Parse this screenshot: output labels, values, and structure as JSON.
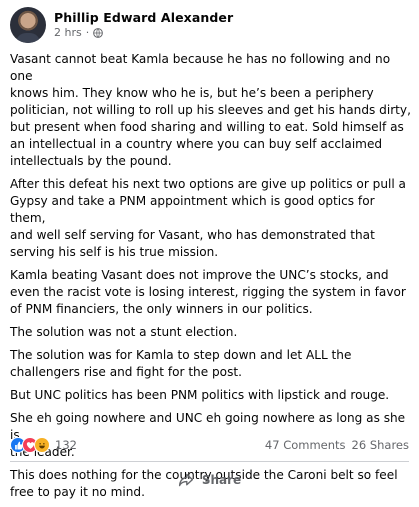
{
  "post": {
    "author": "Phillip Edward Alexander",
    "timestamp": "2 hrs",
    "separator": "·",
    "privacy_icon": "globe-icon",
    "paragraphs": [
      "Vasant cannot beat Kamla because he has no following and no one\nknows him. They know who he is, but he’s been a periphery\npolitician, not willing to roll up his sleeves and get his hands dirty,\nbut present when food sharing and willing to eat. Sold himself as\nan intellectual in a country where you can buy self acclaimed\nintellectuals by the pound.",
      "After this defeat his next two options are give up politics or pull a\nGypsy and take a PNM appointment which is good optics for them,\nand well self serving for Vasant, who has demonstrated that\nserving his self is his true mission.",
      "Kamla beating Vasant does not improve the UNC’s stocks, and\neven the racist vote is losing interest, rigging the system in favor\nof PNM financiers, the only winners in our politics.",
      "The solution was not a stunt election.",
      "The solution was for Kamla to step down and let ALL the\nchallengers rise and fight for the post.",
      "But UNC politics has been PNM politics with lipstick and rouge.",
      "She eh going nowhere and UNC eh going nowhere as long as she is\nthe leader.",
      "This does nothing for the country outside the Caroni belt so feel\nfree to pay it no mind."
    ]
  },
  "stats": {
    "reaction_icons": [
      "like-icon",
      "love-icon",
      "haha-icon"
    ],
    "reaction_count": "132",
    "comments": "47 Comments",
    "shares": "26 Shares"
  },
  "actions": {
    "share_label": "Share",
    "share_icon": "share-arrow-icon"
  },
  "colors": {
    "like": "#1877f2",
    "love": "#f33e58",
    "haha": "#f7b125",
    "secondary_text": "#65676b"
  }
}
